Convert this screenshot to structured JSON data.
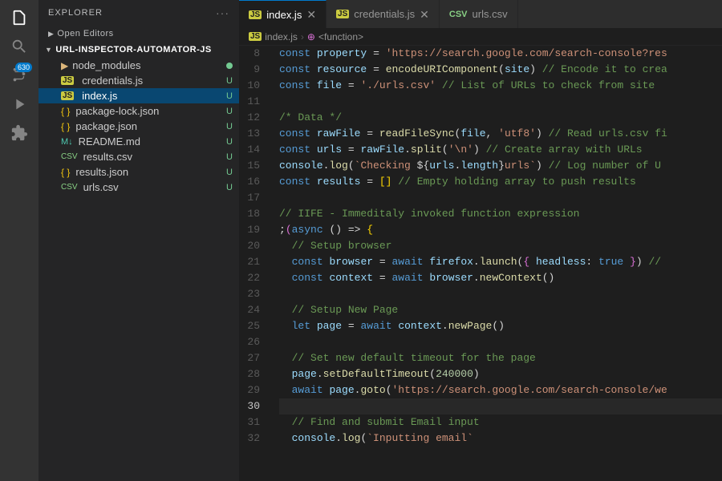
{
  "activityBar": {
    "icons": [
      {
        "name": "files-icon",
        "symbol": "⎘",
        "active": true,
        "badge": null
      },
      {
        "name": "search-icon",
        "symbol": "🔍",
        "active": false,
        "badge": null
      },
      {
        "name": "source-control-icon",
        "symbol": "⑂",
        "active": false,
        "badge": "630"
      },
      {
        "name": "run-icon",
        "symbol": "▶",
        "active": false,
        "badge": null
      },
      {
        "name": "extensions-icon",
        "symbol": "⊞",
        "active": false,
        "badge": null
      }
    ]
  },
  "sidebar": {
    "header": "Explorer",
    "openEditors": "Open Editors",
    "projectName": "URL-INSPECTOR-AUTOMATOR-JS",
    "files": [
      {
        "name": "node_modules",
        "type": "folder",
        "indent": 1,
        "badge": "",
        "dotGreen": true
      },
      {
        "name": "credentials.js",
        "type": "js",
        "indent": 1,
        "badge": "U"
      },
      {
        "name": "index.js",
        "type": "js",
        "indent": 1,
        "badge": "U",
        "active": true
      },
      {
        "name": "package-lock.json",
        "type": "json",
        "indent": 1,
        "badge": "U"
      },
      {
        "name": "package.json",
        "type": "json",
        "indent": 1,
        "badge": "U"
      },
      {
        "name": "README.md",
        "type": "md",
        "indent": 1,
        "badge": "U"
      },
      {
        "name": "results.csv",
        "type": "csv",
        "indent": 1,
        "badge": "U"
      },
      {
        "name": "results.json",
        "type": "json",
        "indent": 1,
        "badge": "U"
      },
      {
        "name": "urls.csv",
        "type": "csv",
        "indent": 1,
        "badge": "U"
      }
    ]
  },
  "tabs": [
    {
      "label": "index.js",
      "type": "js",
      "active": true
    },
    {
      "label": "credentials.js",
      "type": "js",
      "active": false
    },
    {
      "label": "urls.csv",
      "type": "csv",
      "active": false
    }
  ],
  "breadcrumb": {
    "file": "index.js",
    "symbol": "<function>"
  },
  "lines": [
    {
      "num": 8,
      "content": "const property = 'https://search.google.com/search-console?res"
    },
    {
      "num": 9,
      "content": "const resource = encodeURIComponent(site) // Encode it to crea"
    },
    {
      "num": 10,
      "content": "const file = './urls.csv' // List of URLs to check from site"
    },
    {
      "num": 11,
      "content": ""
    },
    {
      "num": 12,
      "content": "/* Data */"
    },
    {
      "num": 13,
      "content": "const rawFile = readFileSync(file, 'utf8') // Read urls.csv fi"
    },
    {
      "num": 14,
      "content": "const urls = rawFile.split('\\n') // Create array with URLs"
    },
    {
      "num": 15,
      "content": "console.log(`Checking ${urls.length} urls`) // Log number of U"
    },
    {
      "num": 16,
      "content": "const results = [] // Empty holding array to push results"
    },
    {
      "num": 17,
      "content": ""
    },
    {
      "num": 18,
      "content": "// IIFE - Immeditaly invoked function expression"
    },
    {
      "num": 19,
      "content": ";(async () => {"
    },
    {
      "num": 20,
      "content": "  // Setup browser"
    },
    {
      "num": 21,
      "content": "  const browser = await firefox.launch({ headless: true }) //"
    },
    {
      "num": 22,
      "content": "  const context = await browser.newContext()"
    },
    {
      "num": 23,
      "content": ""
    },
    {
      "num": 24,
      "content": "  // Setup New Page"
    },
    {
      "num": 25,
      "content": "  let page = await context.newPage()"
    },
    {
      "num": 26,
      "content": ""
    },
    {
      "num": 27,
      "content": "  // Set new default timeout for the page"
    },
    {
      "num": 28,
      "content": "  page.setDefaultTimeout(240000)"
    },
    {
      "num": 29,
      "content": "  await page.goto('https://search.google.com/search-console/we"
    },
    {
      "num": 30,
      "content": ""
    },
    {
      "num": 31,
      "content": "  // Find and submit Email input"
    },
    {
      "num": 32,
      "content": "  console.log(`Inputting email`"
    }
  ],
  "colors": {
    "background": "#1e1e1e",
    "sidebar": "#252526",
    "tabActive": "#1e1e1e",
    "tabInactive": "#2d2d2d",
    "activeHighlight": "#094771",
    "accentBlue": "#007acc"
  }
}
